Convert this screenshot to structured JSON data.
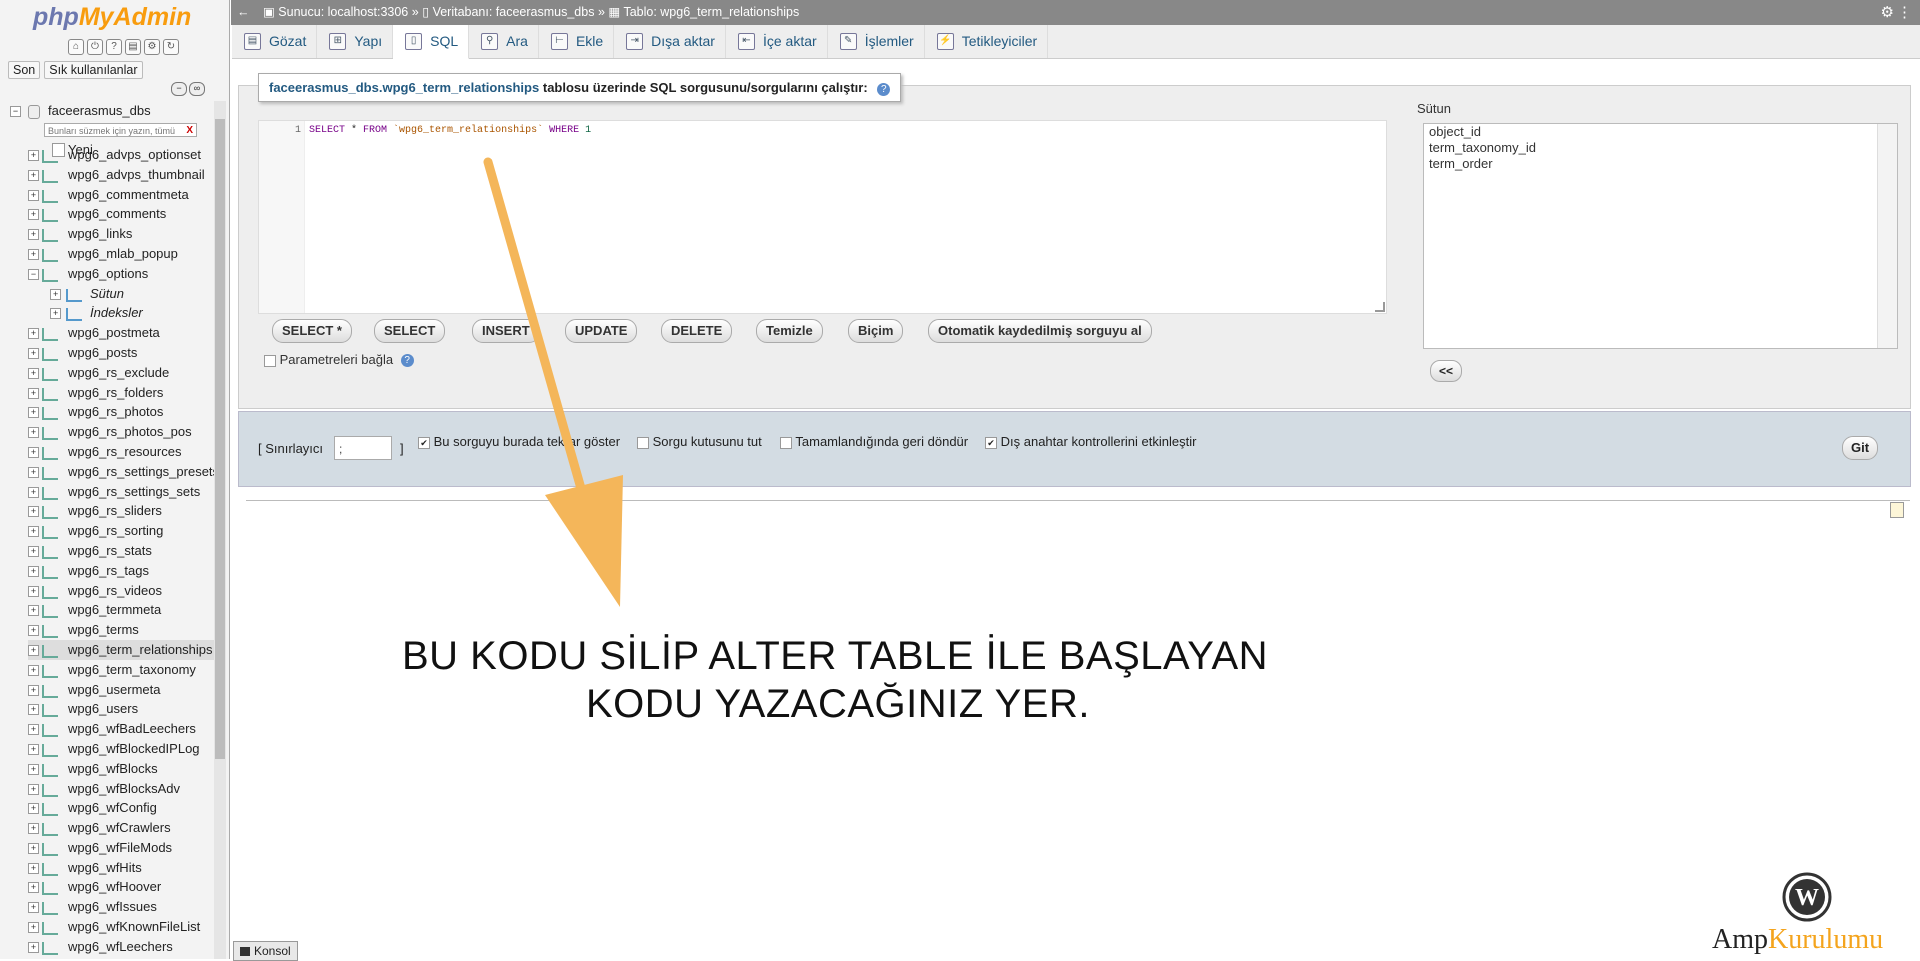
{
  "nav": {
    "logo_php": "php",
    "logo_myadmin": "MyAdmin",
    "tab_recent": "Son",
    "tab_favorites": "Sık kullanılanlar",
    "database": "faceerasmus_dbs",
    "filter_placeholder": "Bunları süzmek için yazın, tümü",
    "new_item": "Yeni",
    "tables": [
      "wpg6_advps_optionset",
      "wpg6_advps_thumbnail",
      "wpg6_commentmeta",
      "wpg6_comments",
      "wpg6_links",
      "wpg6_mlab_popup",
      "wpg6_options",
      "Sütun",
      "İndeksler",
      "wpg6_postmeta",
      "wpg6_posts",
      "wpg6_rs_exclude",
      "wpg6_rs_folders",
      "wpg6_rs_photos",
      "wpg6_rs_photos_pos",
      "wpg6_rs_resources",
      "wpg6_rs_settings_presets",
      "wpg6_rs_settings_sets",
      "wpg6_rs_sliders",
      "wpg6_rs_sorting",
      "wpg6_rs_stats",
      "wpg6_rs_tags",
      "wpg6_rs_videos",
      "wpg6_termmeta",
      "wpg6_terms",
      "wpg6_term_relationships",
      "wpg6_term_taxonomy",
      "wpg6_usermeta",
      "wpg6_users",
      "wpg6_wfBadLeechers",
      "wpg6_wfBlockedIPLog",
      "wpg6_wfBlocks",
      "wpg6_wfBlocksAdv",
      "wpg6_wfConfig",
      "wpg6_wfCrawlers",
      "wpg6_wfFileMods",
      "wpg6_wfHits",
      "wpg6_wfHoover",
      "wpg6_wfIssues",
      "wpg6_wfKnownFileList",
      "wpg6_wfLeechers"
    ]
  },
  "breadcrumb": {
    "server": "Sunucu: localhost:3306",
    "database": "Veritabanı: faceerasmus_dbs",
    "table": "Tablo: wpg6_term_relationships",
    "sep": "»"
  },
  "tabs": [
    "Gözat",
    "Yapı",
    "SQL",
    "Ara",
    "Ekle",
    "Dışa aktar",
    "İçe aktar",
    "İşlemler",
    "Tetikleyiciler"
  ],
  "sql": {
    "legend_table": "faceerasmus_dbs.wpg6_term_relationships",
    "legend_text": "tablosu üzerinde SQL sorgusunu/sorgularını çalıştır:",
    "line_number": "1",
    "code_select": "SELECT",
    "code_star": " * ",
    "code_from": "FROM",
    "code_table": " `wpg6_term_relationships` ",
    "code_where": "WHERE",
    "code_one": " 1",
    "buttons": [
      "SELECT *",
      "SELECT",
      "INSERT",
      "UPDATE",
      "DELETE",
      "Temizle",
      "Biçim",
      "Otomatik kaydedilmiş sorguyu al"
    ],
    "bind_params": "Parametreleri bağla",
    "columns_label": "Sütun",
    "columns": [
      "object_id",
      "term_taxonomy_id",
      "term_order"
    ],
    "insert_button": "<<"
  },
  "options": {
    "delimiter_label_open": "[ Sınırlayıcı",
    "delimiter_value": ";",
    "delimiter_label_close": "]",
    "show_query": "Bu sorguyu burada tekrar göster",
    "keep_box": "Sorgu kutusunu tut",
    "rollback": "Tamamlandığında geri döndür",
    "fk_checks": "Dış anahtar kontrollerini etkinleştir",
    "go": "Git"
  },
  "annotation": {
    "line1": "BU KODU SİLİP ALTER TABLE İLE BAŞLAYAN",
    "line2": "KODU YAZACAĞINIZ YER.",
    "arrow_color": "#f4b65a"
  },
  "console": "Konsol",
  "watermark": {
    "part1": "Amp",
    "part2": "Kurulumu"
  },
  "colors": {
    "link": "#235a81",
    "topbar": "#888888",
    "accent": "#f4a41d"
  }
}
